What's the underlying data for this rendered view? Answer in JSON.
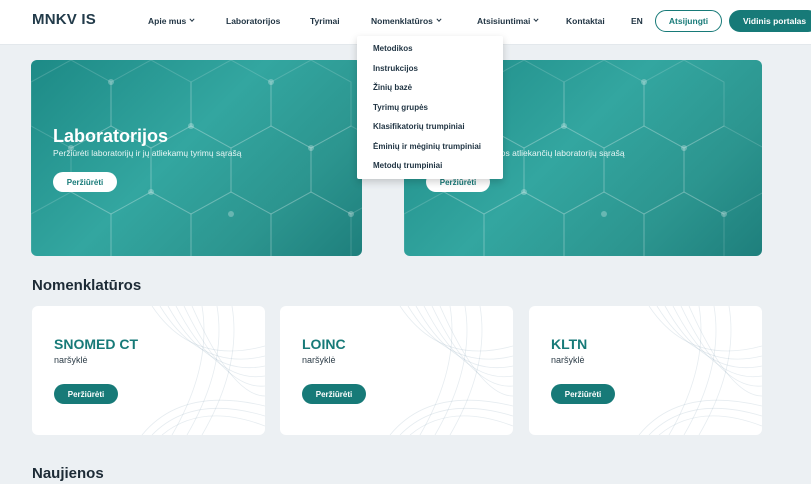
{
  "header": {
    "logo": "MNKV IS",
    "nav": [
      {
        "label": "Apie mus",
        "has_dropdown": true
      },
      {
        "label": "Laboratorijos",
        "has_dropdown": false
      },
      {
        "label": "Tyrimai",
        "has_dropdown": false
      },
      {
        "label": "Nomenklatūros",
        "has_dropdown": true
      },
      {
        "label": "Atsisiuntimai",
        "has_dropdown": true
      },
      {
        "label": "Kontaktai",
        "has_dropdown": false
      },
      {
        "label": "EN",
        "has_dropdown": false
      }
    ],
    "logout_label": "Atsijungti",
    "portal_label": "Vidinis portalas"
  },
  "dropdown": {
    "open_for": "Nomenklatūros",
    "items": [
      "Metodikos",
      "Instrukcijos",
      "Žinių bazė",
      "Tyrimų grupės",
      "Klasifikatorių trumpiniai",
      "Ėminių ir mėginių trumpiniai",
      "Metodų trumpiniai"
    ]
  },
  "hero": [
    {
      "title": "Laboratorijos",
      "subtitle": "Peržiūrėti laboratorijų ir jų atliekamų tyrimų sąrašą",
      "button": "Peržiūrėti"
    },
    {
      "title": "",
      "subtitle": "r juos atliekančių laboratorijų sąrašą",
      "button": "Peržiūrėti"
    }
  ],
  "nomenclature_section": {
    "title": "Nomenklatūros",
    "cards": [
      {
        "title": "SNOMED CT",
        "subtitle": "naršyklė",
        "button": "Peržiūrėti"
      },
      {
        "title": "LOINC",
        "subtitle": "naršyklė",
        "button": "Peržiūrėti"
      },
      {
        "title": "KLTN",
        "subtitle": "naršyklė",
        "button": "Peržiūrėti"
      }
    ]
  },
  "news_section": {
    "title": "Naujienos"
  },
  "colors": {
    "accent": "#177a78",
    "hero_teal": "#2c958f",
    "page_bg": "#ecf0f3"
  },
  "icons": {
    "dropdown_indicator": "chevron-down-icon"
  }
}
